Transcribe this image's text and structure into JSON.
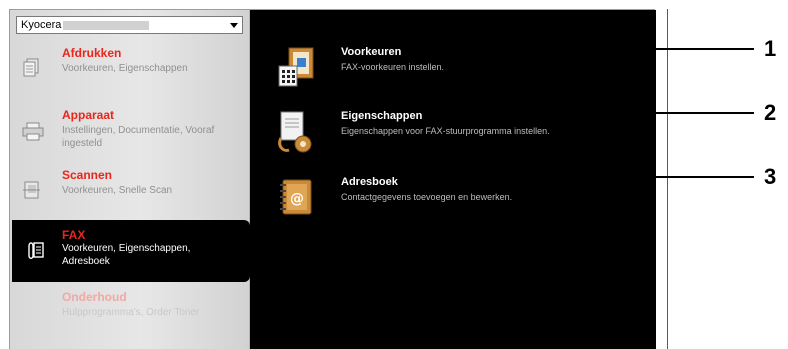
{
  "device_select": {
    "value": "Kyocera"
  },
  "sidebar": {
    "items": [
      {
        "title": "Afdrukken",
        "desc": "Voorkeuren, Eigenschappen",
        "icon": "document-icon"
      },
      {
        "title": "Apparaat",
        "desc": "Instellingen, Documentatie, Vooraf ingesteld",
        "icon": "printer-icon"
      },
      {
        "title": "Scannen",
        "desc": "Voorkeuren, Snelle Scan",
        "icon": "scanner-icon"
      },
      {
        "title": "FAX",
        "desc": "Voorkeuren, Eigenschappen, Adresboek",
        "icon": "fax-icon"
      },
      {
        "title": "Onderhoud",
        "desc": "Hulpprogramma's, Order Toner",
        "icon": "maintenance-icon"
      }
    ]
  },
  "content": {
    "items": [
      {
        "title": "Voorkeuren",
        "desc": "FAX-voorkeuren instellen.",
        "icon": "preferences-icon"
      },
      {
        "title": "Eigenschappen",
        "desc": "Eigenschappen voor FAX-stuurprogramma instellen.",
        "icon": "properties-icon"
      },
      {
        "title": "Adresboek",
        "desc": "Contactgegevens toevoegen en bewerken.",
        "icon": "address-book-icon"
      }
    ]
  },
  "callouts": [
    "1",
    "2",
    "3"
  ],
  "colors": {
    "accent": "#e8261c",
    "panel": "#000000",
    "sidebar": "#e0e0e0"
  }
}
